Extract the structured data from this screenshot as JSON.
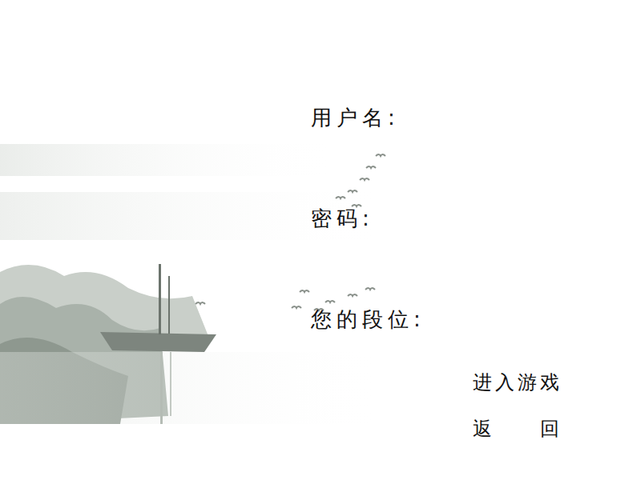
{
  "form": {
    "fields": [
      {
        "label": "用户名:"
      },
      {
        "label": "密码:"
      },
      {
        "label": "您的段位:"
      }
    ]
  },
  "buttons": [
    {
      "label": "进入游戏"
    },
    {
      "label": "返　　回"
    }
  ]
}
